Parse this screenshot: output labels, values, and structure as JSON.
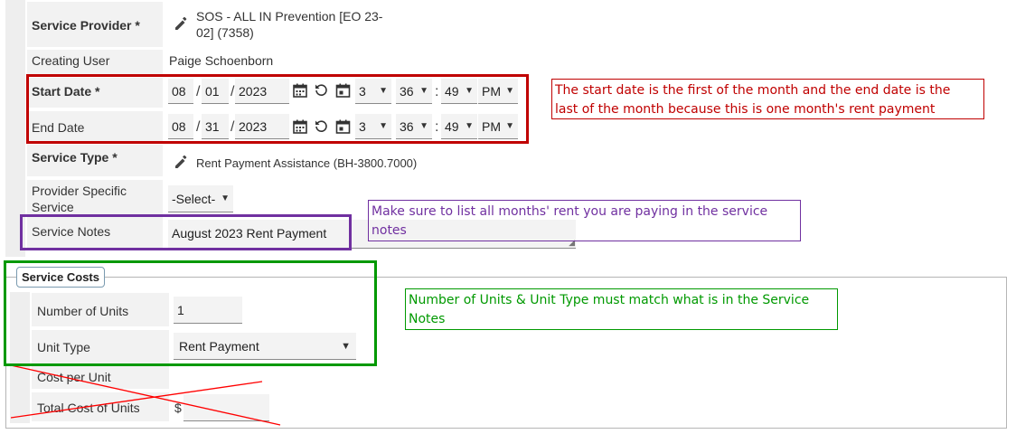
{
  "service_provider": {
    "label": "Service Provider *",
    "value_line1": "SOS - ALL IN Prevention [EO 23-",
    "value_line2": "02] (7358)",
    "edit_icon": "pencil-icon"
  },
  "creating_user": {
    "label": "Creating User",
    "value": "Paige Schoenborn"
  },
  "start_date": {
    "label": "Start Date *",
    "month": "08",
    "day": "01",
    "year": "2023",
    "hour": "3",
    "minute": "36",
    "second": "49",
    "ampm": "PM"
  },
  "end_date": {
    "label": "End Date",
    "month": "08",
    "day": "31",
    "year": "2023",
    "hour": "3",
    "minute": "36",
    "second": "49",
    "ampm": "PM"
  },
  "separators": {
    "date": "/",
    "time": ":"
  },
  "service_type": {
    "label": "Service Type *",
    "value": "Rent Payment Assistance (BH-3800.7000)"
  },
  "provider_specific": {
    "label_line1": "Provider Specific",
    "label_line2": "Service",
    "value": "-Select-"
  },
  "service_notes": {
    "label": "Service Notes",
    "value": "August 2023 Rent Payment"
  },
  "service_costs": {
    "legend": "Service Costs",
    "number_of_units_label": "Number of Units",
    "number_of_units_value": "1",
    "unit_type_label": "Unit Type",
    "unit_type_value": "Rent Payment",
    "cost_per_unit_label": "Cost per Unit",
    "total_cost_label": "Total Cost of Units",
    "currency": "$"
  },
  "annotations": {
    "dates_line1": "The start date is the first of the month and the end date is the",
    "dates_line2": "last of the month because this is one month's rent payment",
    "notes_line1": "Make sure to list all months' rent you are paying in the service",
    "notes_line2": "notes",
    "units_line1": "Number of Units & Unit Type must match what is in the Service",
    "units_line2": "Notes"
  },
  "colors": {
    "red": "#c00000",
    "purple": "#7030a0",
    "green": "#009900"
  }
}
